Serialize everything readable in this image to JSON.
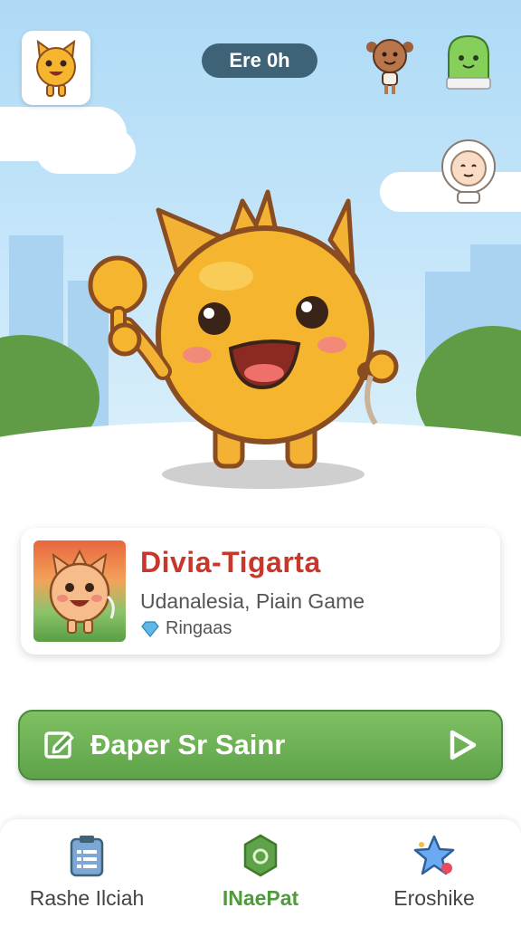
{
  "header": {
    "pill_label": "Ere 0h"
  },
  "icons": {
    "top_left_avatar": "cat-character-icon",
    "top_right_1": "girl-character-icon",
    "top_right_2": "green-blob-character-icon",
    "top_right_3": "astronaut-character-icon"
  },
  "game_card": {
    "title": "Divia-Tigarta",
    "subtitle": "Udanalesia, Piain Game",
    "tag": "Ringaas",
    "tag_icon": "gem-icon"
  },
  "cta": {
    "label": "Ðaper Sr Sainr",
    "left_icon": "edit-icon",
    "right_icon": "play-icon"
  },
  "tabs": [
    {
      "label": "Rashe Ilciah",
      "icon": "clipboard-icon",
      "active": false
    },
    {
      "label": "INaePat",
      "icon": "hexagon-icon",
      "active": true
    },
    {
      "label": "Eroshike",
      "icon": "star-icon",
      "active": false
    }
  ],
  "colors": {
    "sky": "#aedaf6",
    "pill": "#3f6376",
    "title": "#c9362a",
    "green": "#5ea34a",
    "active_tab": "#4f9a3d"
  }
}
